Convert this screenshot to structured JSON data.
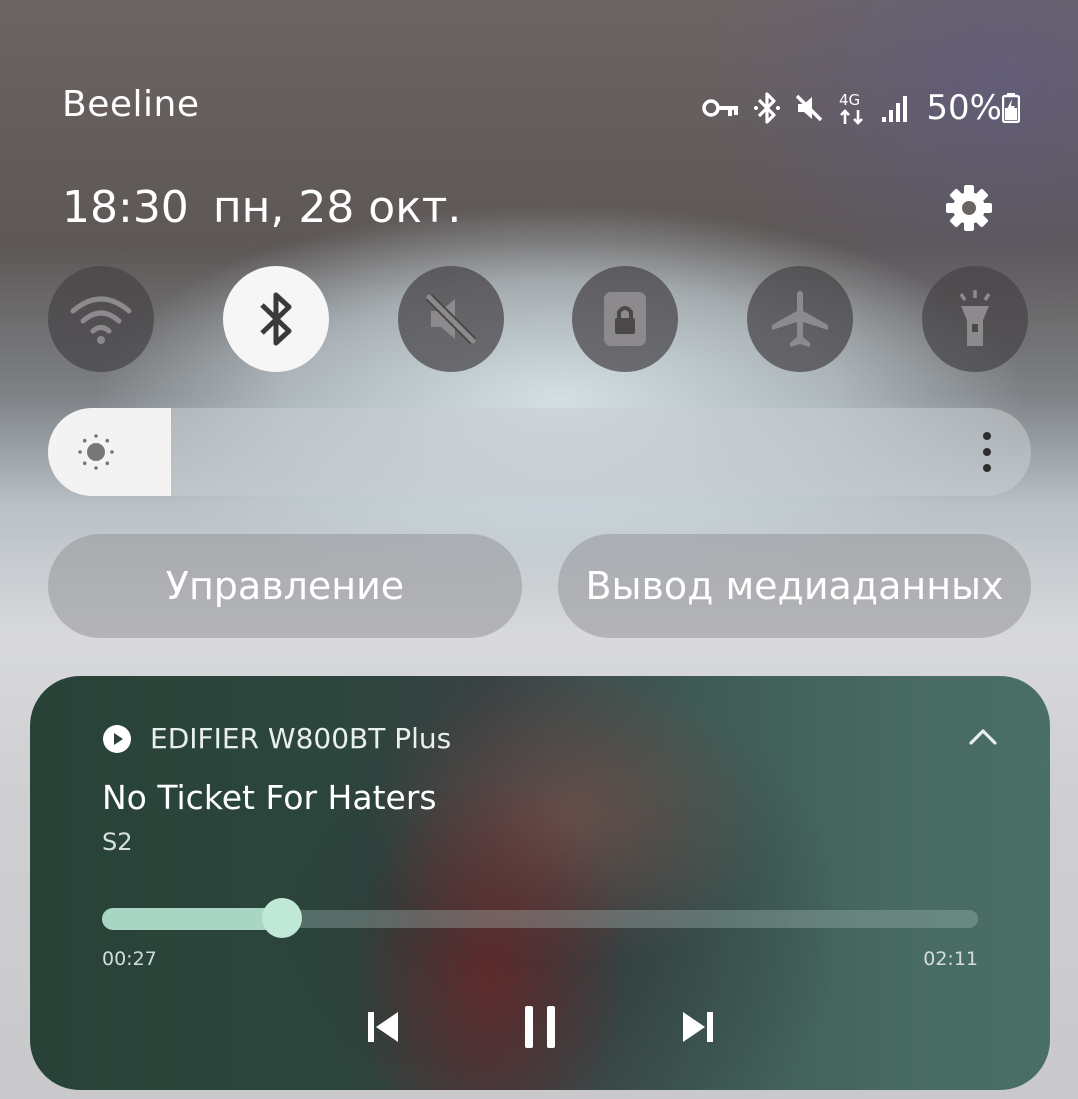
{
  "status_bar": {
    "carrier": "Beeline",
    "network": "4G",
    "battery": "50%",
    "icons": [
      "vpn-key-icon",
      "bluetooth-icon",
      "mute-icon",
      "4g-icon",
      "signal-icon",
      "battery-charging-icon"
    ]
  },
  "header": {
    "time": "18:30",
    "date": "пн, 28 окт.",
    "settings_icon": "gear-icon"
  },
  "quick_settings": [
    {
      "icon": "wifi-icon",
      "active": false
    },
    {
      "icon": "bluetooth-icon",
      "active": true
    },
    {
      "icon": "mute-icon",
      "active": false
    },
    {
      "icon": "screen-lock-icon",
      "active": false
    },
    {
      "icon": "airplane-icon",
      "active": false
    },
    {
      "icon": "flashlight-icon",
      "active": false
    }
  ],
  "brightness": {
    "level": 0.125,
    "icon": "sun-icon"
  },
  "buttons": {
    "control": "Управление",
    "media_output": "Вывод медиаданных"
  },
  "media": {
    "device": "EDIFIER W800BT Plus",
    "title": "No Ticket For Haters",
    "artist": "S2",
    "position": "00:27",
    "duration": "02:11",
    "progress": 0.206,
    "accent": "#a9d6c4"
  },
  "colors": {
    "tile_off": "#464446",
    "tile_on": "#f6f6f6"
  }
}
